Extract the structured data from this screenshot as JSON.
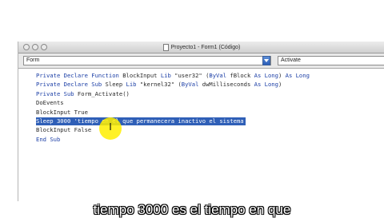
{
  "window": {
    "title": "Proyecto1 - Form1 (Código)"
  },
  "toolbar": {
    "object_combo": "Form",
    "procedure_combo": "Activate"
  },
  "code": {
    "lines": [
      {
        "text": "Private Declare Function BlockInput Lib \"user32\" (ByVal fBlock As Long) As Long"
      },
      {
        "text": "Private Declare Sub Sleep Lib \"kernel32\" (ByVal dwMilliseconds As Long)"
      },
      {
        "text": "Private Sub Form_Activate()"
      },
      {
        "text": "DoEvents"
      },
      {
        "text": "BlockInput True"
      },
      {
        "text": "Sleep 3000 'tiempo en el que permanecera inactivo el sistema",
        "selected": true
      },
      {
        "text": "BlockInput False"
      },
      {
        "text": "End Sub"
      }
    ]
  },
  "caption": {
    "text": "tiempo 3000 es el tiempo en que"
  },
  "colors": {
    "selection": "#2f5fb7",
    "keyword": "#1c3fa6",
    "cursor_highlight": "#ffee00"
  }
}
